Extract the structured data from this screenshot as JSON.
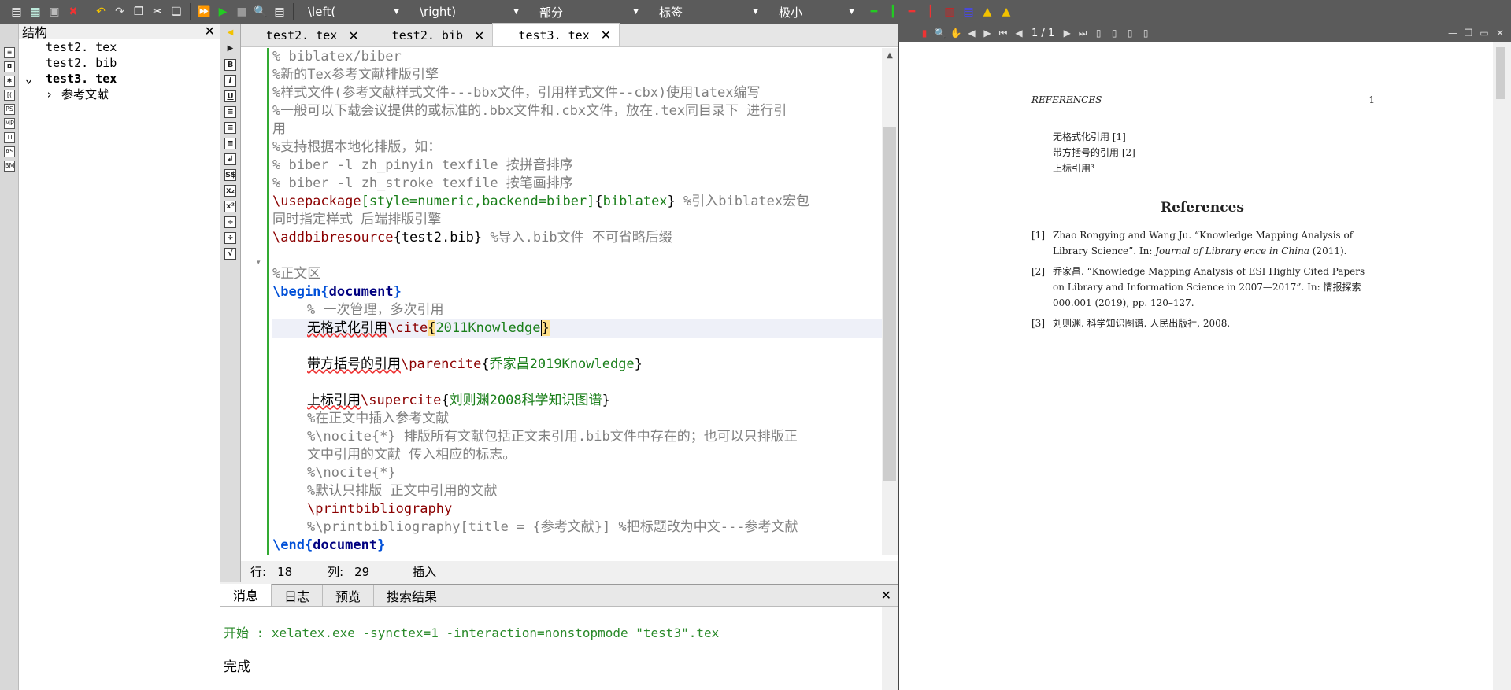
{
  "toolbar": {
    "dropdowns": [
      {
        "label": "\\left(",
        "options": []
      },
      {
        "label": "\\right)",
        "options": []
      },
      {
        "label": "部分",
        "options": []
      },
      {
        "label": "标签",
        "options": []
      },
      {
        "label": "极小",
        "options": []
      }
    ],
    "icons": [
      "new-file-icon",
      "new-from-template-icon",
      "save-icon",
      "close-file-icon",
      "undo-icon",
      "redo-icon",
      "paste-icon",
      "cut-icon",
      "copy-icon",
      "compile-icon",
      "run-icon",
      "stop-icon",
      "view-pdf-icon",
      "view-log-icon"
    ]
  },
  "structure": {
    "title": "结构",
    "items": [
      {
        "label": "test2. tex",
        "bold": false
      },
      {
        "label": "test2. bib",
        "bold": false
      },
      {
        "label": "test3. tex",
        "bold": true
      },
      {
        "label": "参考文献",
        "bold": false
      }
    ]
  },
  "editor": {
    "tabs": [
      {
        "label": "test2. tex",
        "active": false
      },
      {
        "label": "test2. bib",
        "active": false
      },
      {
        "label": "test3. tex",
        "active": true
      }
    ],
    "lines": {
      "l1": "% biblatex/biber",
      "l2": "%新的Tex参考文献排版引擎",
      "l3": "%样式文件(参考文献样式文件---bbx文件，引用样式文件--cbx)使用latex编写",
      "l4a": "%一般可以下载会议提供的或标准的.bbx文件和.cbx文件，放在.tex同目录下 进行引",
      "l4b": "用",
      "l5": "%支持根据本地化排版，如：",
      "l6": "%   biber -l zh_pinyin texfile 按拼音排序",
      "l7": "%   biber -l zh_stroke texfile 按笔画排序",
      "l8_cmd": "\\usepackage",
      "l8_opt": "[style=numeric,backend=biber]",
      "l8_arg": "biblatex",
      "l8_cm": " %引入biblatex宏包",
      "l8b": "同时指定样式 后端排版引擎",
      "l9_cmd": "\\addbibresource",
      "l9_arg": "test2.bib",
      "l9_cm": " %导入.bib文件  不可省略后缀",
      "l11": "%正文区",
      "l12_cmd": "\\begin",
      "l12_arg": "document",
      "l13": "% 一次管理，多次引用",
      "l14_text": "无格式化引用",
      "l14_cmd": "\\cite",
      "l14_arg": "2011Knowledge",
      "l16_text": "带方括号的引用",
      "l16_cmd": "\\parencite",
      "l16_arg": "乔家昌2019Knowledge",
      "l18_text": "上标引用",
      "l18_cmd": "\\supercite",
      "l18_arg": "刘则渊2008科学知识图谱",
      "l19": "%在正文中插入参考文献",
      "l20a": "%\\nocite{*} 排版所有文献包括正文未引用.bib文件中存在的；也可以只排版正",
      "l20b": "文中引用的文献 传入相应的标志。",
      "l21": "%\\nocite{*}",
      "l22": "%默认只排版 正文中引用的文献",
      "l23": "\\printbibliography",
      "l24": "%\\printbibliography[title = {参考文献}] %把标题改为中文---参考文献",
      "l25_cmd": "\\end",
      "l25_arg": "document"
    }
  },
  "status": {
    "row_label": "行:",
    "row": "18",
    "col_label": "列:",
    "col": "29",
    "mode": "插入"
  },
  "bottom_panel": {
    "tabs": [
      "消息",
      "日志",
      "预览",
      "搜索结果"
    ],
    "active_tab": "消息",
    "log_start": "开始 : xelatex.exe -synctex=1 -interaction=nonstopmode \"test3\".tex",
    "log_done": "完成"
  },
  "pdf": {
    "page_indicator": "1 / 1",
    "running_head": "REFERENCES",
    "page_number": "1",
    "cite_lines": [
      "无格式化引用 [1]",
      "带方括号的引用 [2]",
      "上标引用³"
    ],
    "references_title": "References",
    "references": [
      {
        "num": "[1]",
        "pre": "Zhao Rongying and Wang Ju. “Knowledge Mapping Analysis of Library Science”. In: ",
        "journal": "Journal of Library ence in China",
        "post": " (2011)."
      },
      {
        "num": "[2]",
        "pre": "乔家昌. “Knowledge Mapping Analysis of ESI Highly Cited Papers on Library and Information Science in 2007—2017”. In: 情报探索 000.001 (2019), pp. 120–127.",
        "journal": "",
        "post": ""
      },
      {
        "num": "[3]",
        "pre": "刘则渊. 科学知识图谱. 人民出版社, 2008.",
        "journal": "",
        "post": ""
      }
    ]
  }
}
